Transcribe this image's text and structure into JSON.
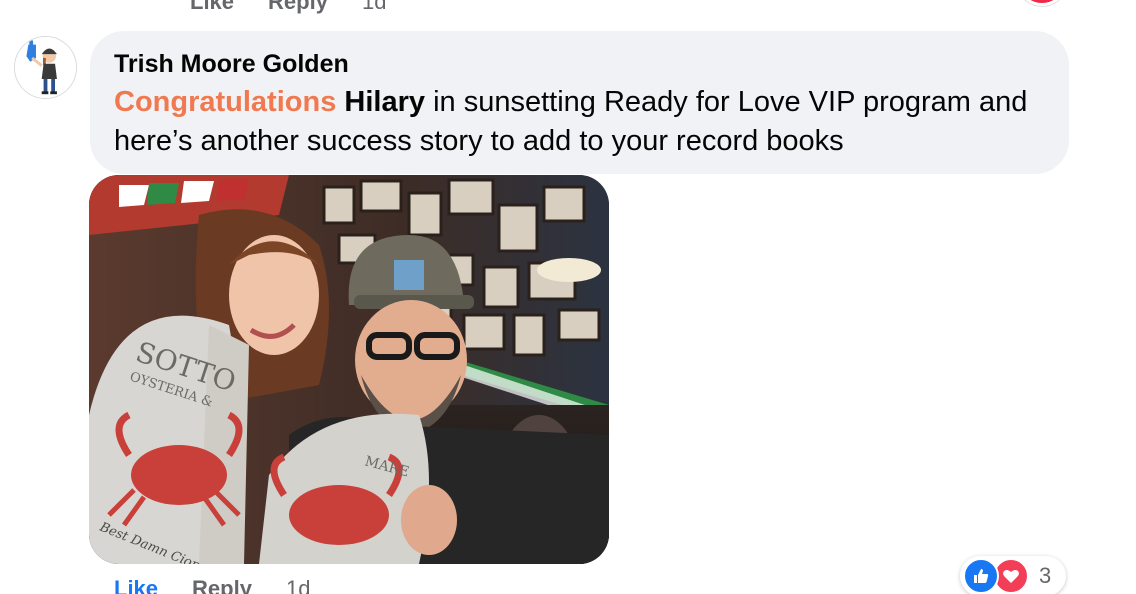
{
  "previous_comment": {
    "actions": {
      "like_label": "Like",
      "reply_label": "Reply",
      "time": "1d"
    }
  },
  "comment": {
    "author": "Trish Moore Golden",
    "highlight": "Congratulations",
    "mention": "Hilary",
    "text_after_mention": " in sunsetting Ready for Love VIP program and here’s another success story to add to your record books",
    "photo": {
      "bib_brand": "SOTTO",
      "bib_sub": "OYSTERIA &",
      "bib_sub2": "MARE",
      "bib_script": "Best Damn Cioppino!"
    },
    "actions": {
      "like_label": "Like",
      "reply_label": "Reply",
      "time": "1d"
    },
    "reactions": {
      "types": [
        "like-icon",
        "love-icon"
      ],
      "count": "3"
    }
  },
  "colors": {
    "highlight": "#f0794f",
    "like_blue": "#1877f2",
    "love_red": "#f33e58",
    "bubble_bg": "#f0f2f5",
    "meta_gray": "#65676b"
  }
}
